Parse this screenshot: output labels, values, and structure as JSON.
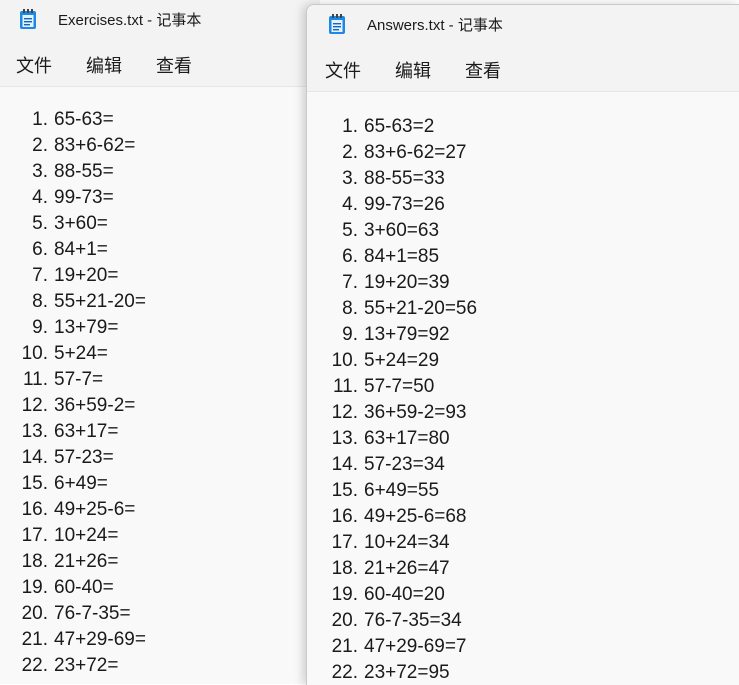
{
  "left_window": {
    "title": "Exercises.txt - 记事本",
    "menu": [
      "文件",
      "编辑",
      "查看"
    ],
    "lines": [
      {
        "n": "1.",
        "t": "65-63="
      },
      {
        "n": "2.",
        "t": "83+6-62="
      },
      {
        "n": "3.",
        "t": "88-55="
      },
      {
        "n": "4.",
        "t": "99-73="
      },
      {
        "n": "5.",
        "t": "3+60="
      },
      {
        "n": "6.",
        "t": "84+1="
      },
      {
        "n": "7.",
        "t": "19+20="
      },
      {
        "n": "8.",
        "t": "55+21-20="
      },
      {
        "n": "9.",
        "t": "13+79="
      },
      {
        "n": "10.",
        "t": "5+24="
      },
      {
        "n": "11.",
        "t": "57-7="
      },
      {
        "n": "12.",
        "t": "36+59-2="
      },
      {
        "n": "13.",
        "t": "63+17="
      },
      {
        "n": "14.",
        "t": "57-23="
      },
      {
        "n": "15.",
        "t": "6+49="
      },
      {
        "n": "16.",
        "t": "49+25-6="
      },
      {
        "n": "17.",
        "t": "10+24="
      },
      {
        "n": "18.",
        "t": "21+26="
      },
      {
        "n": "19.",
        "t": "60-40="
      },
      {
        "n": "20.",
        "t": "76-7-35="
      },
      {
        "n": "21.",
        "t": "47+29-69="
      },
      {
        "n": "22.",
        "t": "23+72="
      }
    ]
  },
  "right_window": {
    "title": "Answers.txt - 记事本",
    "menu": [
      "文件",
      "编辑",
      "查看"
    ],
    "lines": [
      {
        "n": "1.",
        "t": "65-63=2"
      },
      {
        "n": "2.",
        "t": "83+6-62=27"
      },
      {
        "n": "3.",
        "t": "88-55=33"
      },
      {
        "n": "4.",
        "t": "99-73=26"
      },
      {
        "n": "5.",
        "t": "3+60=63"
      },
      {
        "n": "6.",
        "t": "84+1=85"
      },
      {
        "n": "7.",
        "t": "19+20=39"
      },
      {
        "n": "8.",
        "t": "55+21-20=56"
      },
      {
        "n": "9.",
        "t": "13+79=92"
      },
      {
        "n": "10.",
        "t": "5+24=29"
      },
      {
        "n": "11.",
        "t": "57-7=50"
      },
      {
        "n": "12.",
        "t": "36+59-2=93"
      },
      {
        "n": "13.",
        "t": "63+17=80"
      },
      {
        "n": "14.",
        "t": "57-23=34"
      },
      {
        "n": "15.",
        "t": "6+49=55"
      },
      {
        "n": "16.",
        "t": "49+25-6=68"
      },
      {
        "n": "17.",
        "t": "10+24=34"
      },
      {
        "n": "18.",
        "t": "21+26=47"
      },
      {
        "n": "19.",
        "t": "60-40=20"
      },
      {
        "n": "20.",
        "t": "76-7-35=34"
      },
      {
        "n": "21.",
        "t": "47+29-69=7"
      },
      {
        "n": "22.",
        "t": "23+72=95"
      }
    ]
  },
  "icons": {
    "app": "notepad-icon"
  },
  "colors": {
    "icon_blue": "#1e88e5",
    "text": "#1a1a1a",
    "background": "#f9f9f9"
  }
}
